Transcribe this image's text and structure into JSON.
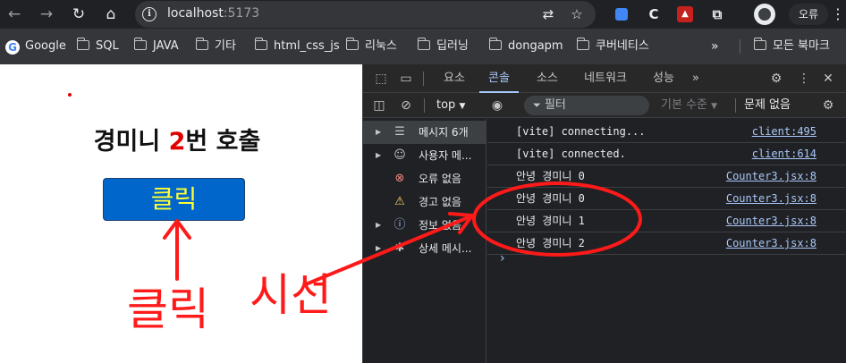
{
  "browser": {
    "back_icon": "arrow-left-icon",
    "forward_icon": "arrow-right-icon",
    "reload_icon": "reload-icon",
    "home_icon": "home-icon",
    "url_host": "localhost",
    "url_port": ":5173",
    "profile_chip": "오류",
    "accent_color": "#a8c7fa"
  },
  "bookmarks": {
    "items": [
      {
        "label": "Google",
        "icon": "google-icon"
      },
      {
        "label": "SQL",
        "icon": "folder-icon"
      },
      {
        "label": "JAVA",
        "icon": "folder-icon"
      },
      {
        "label": "기타",
        "icon": "folder-icon"
      },
      {
        "label": "html_css_js",
        "icon": "folder-icon"
      },
      {
        "label": "리눅스",
        "icon": "folder-icon"
      },
      {
        "label": "딥러닝",
        "icon": "folder-icon"
      },
      {
        "label": "dongapm",
        "icon": "folder-icon"
      },
      {
        "label": "쿠버네티스",
        "icon": "folder-icon"
      }
    ],
    "more": "»",
    "all_bookmarks": "모든 북마크"
  },
  "page": {
    "heading_prefix": "경미니 ",
    "heading_count": "2",
    "heading_suffix": "번 호출",
    "button_label": "클릭",
    "annotation_click": "클릭",
    "annotation_gaze": "시선",
    "annotation_color": "#ff1a1a",
    "button_color": "#0066cc",
    "button_text_color": "#ffff33"
  },
  "devtools": {
    "tabs": [
      "요소",
      "콘솔",
      "소스",
      "네트워크",
      "성능"
    ],
    "active_tab": "콘솔",
    "more_tabs": "»",
    "context": "top",
    "filter_placeholder": "필터",
    "levels": "기본 수준",
    "issues": "문제 없음",
    "sidebar": [
      {
        "label": "메시지 6개",
        "icon": "list-icon",
        "color": "#c4c7c5"
      },
      {
        "label": "사용자 메...",
        "icon": "user-icon",
        "color": "#c4c7c5"
      },
      {
        "label": "오류 없음",
        "icon": "error-icon",
        "color": "#f28b82"
      },
      {
        "label": "경고 없음",
        "icon": "warning-icon",
        "color": "#fdd663"
      },
      {
        "label": "정보 없음",
        "icon": "info-icon",
        "color": "#a8c7fa"
      },
      {
        "label": "상세 메시...",
        "icon": "bug-icon",
        "color": "#c4c7c5"
      }
    ],
    "console_rows": [
      {
        "msg": "[vite] connecting...",
        "src": "client:495"
      },
      {
        "msg": "[vite] connected.",
        "src": "client:614"
      },
      {
        "msg": "안녕 경미니 0",
        "src": "Counter3.jsx:8"
      },
      {
        "msg": "안녕 경미니 0",
        "src": "Counter3.jsx:8"
      },
      {
        "msg": "안녕 경미니 1",
        "src": "Counter3.jsx:8"
      },
      {
        "msg": "안녕 경미니 2",
        "src": "Counter3.jsx:8"
      }
    ],
    "prompt": "›"
  }
}
